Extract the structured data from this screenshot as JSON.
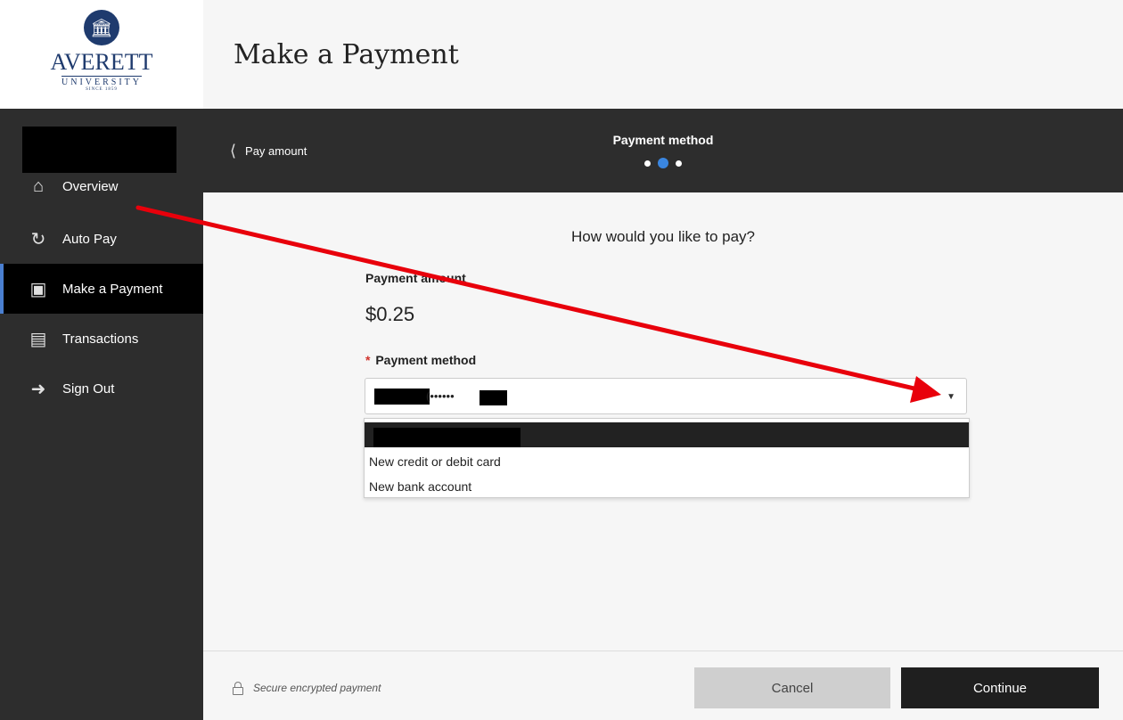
{
  "logo": {
    "name": "AVERETT",
    "sub": "UNIVERSITY",
    "since": "SINCE 1859"
  },
  "header": {
    "title": "Make a Payment"
  },
  "sidebar": {
    "items": [
      {
        "label": "Overview",
        "icon": "home-icon"
      },
      {
        "label": "Auto Pay",
        "icon": "autopay-icon"
      },
      {
        "label": "Make a Payment",
        "icon": "register-icon",
        "active": true
      },
      {
        "label": "Transactions",
        "icon": "receipt-icon"
      },
      {
        "label": "Sign Out",
        "icon": "sign-out-icon"
      }
    ]
  },
  "stepbar": {
    "back_label": "Pay amount",
    "title": "Payment method",
    "current_step": 2,
    "total_steps": 3
  },
  "main": {
    "question": "How would you like to pay?",
    "amount_label": "Payment amount",
    "amount_value": "$0.25",
    "method_label": "Payment method",
    "required_mark": "*",
    "selected_partial": "(••••••",
    "options": [
      "New credit or debit card",
      "New bank account"
    ]
  },
  "footer": {
    "secure_text": "Secure encrypted payment",
    "cancel_label": "Cancel",
    "continue_label": "Continue"
  },
  "colors": {
    "sidebar_bg": "#2d2d2d",
    "active_accent": "#4a7fd0",
    "step_dot_current": "#3a86e0",
    "required": "#d0322b",
    "annotation_arrow": "#e8000b"
  }
}
